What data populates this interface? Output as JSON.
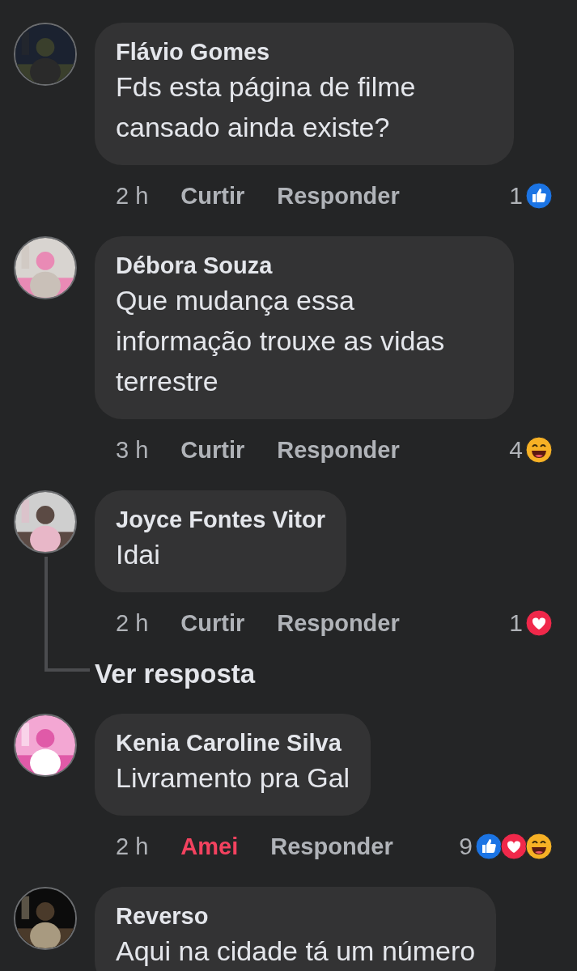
{
  "comments": [
    {
      "author": "Flávio Gomes",
      "text": "Fds esta página de filme cansado ainda existe?",
      "time": "2 h",
      "like": {
        "label": "Curtir",
        "active": false
      },
      "reply": "Responder",
      "reaction_count": "1",
      "reactions": [
        {
          "kind": "like"
        }
      ]
    },
    {
      "author": "Débora Souza",
      "text": "Que mudança essa informação trouxe as vidas terrestre",
      "time": "3 h",
      "like": {
        "label": "Curtir",
        "active": false
      },
      "reply": "Responder",
      "reaction_count": "4",
      "reactions": [
        {
          "kind": "haha"
        }
      ]
    },
    {
      "author": "Joyce Fontes Vitor",
      "text": "Idai",
      "time": "2 h",
      "like": {
        "label": "Curtir",
        "active": false
      },
      "reply": "Responder",
      "reaction_count": "1",
      "reactions": [
        {
          "kind": "love"
        }
      ],
      "replies_link": "Ver resposta"
    },
    {
      "author": "Kenia Caroline Silva",
      "text": "Livramento pra Gal",
      "time": "2 h",
      "like": {
        "label": "Amei",
        "active": true
      },
      "reply": "Responder",
      "reaction_count": "9",
      "reactions": [
        {
          "kind": "like"
        },
        {
          "kind": "love"
        },
        {
          "kind": "haha"
        }
      ]
    },
    {
      "author": "Reverso",
      "text": "Aqui na cidade tá um número"
    }
  ]
}
